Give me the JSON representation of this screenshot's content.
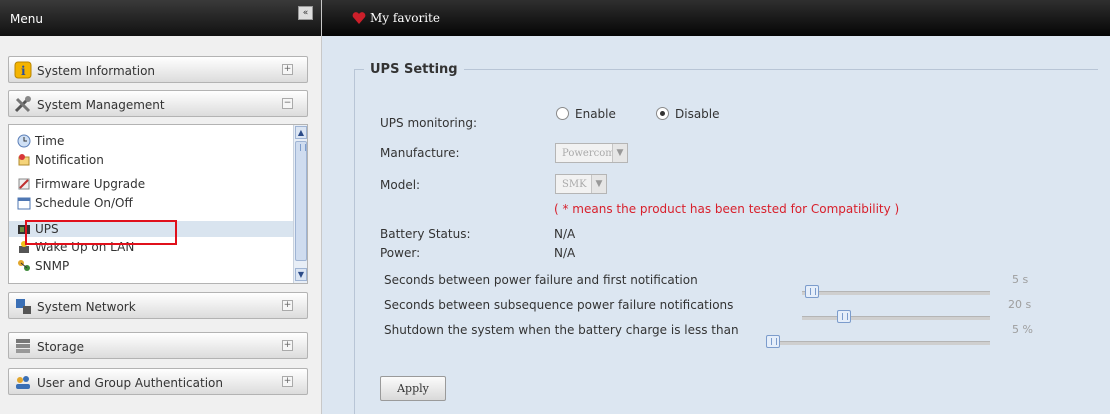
{
  "sidebar": {
    "title": "Menu",
    "collapse_glyph": "«",
    "categories": [
      {
        "label": "System Information",
        "icon": "info-icon",
        "toggle": "+"
      },
      {
        "label": "System Management",
        "icon": "tools-icon",
        "toggle": "−"
      },
      {
        "label": "System Network",
        "icon": "network-icon",
        "toggle": "+"
      },
      {
        "label": "Storage",
        "icon": "storage-icon",
        "toggle": "+"
      },
      {
        "label": "User and Group Authentication",
        "icon": "users-icon",
        "toggle": "+"
      }
    ],
    "submenu": [
      {
        "label": "Time",
        "icon": "clock-icon"
      },
      {
        "label": "Notification",
        "icon": "notification-icon"
      },
      {
        "label": "Firmware Upgrade",
        "icon": "firmware-icon"
      },
      {
        "label": "Schedule On/Off",
        "icon": "schedule-icon"
      },
      {
        "label": "UPS",
        "icon": "ups-icon",
        "selected": true
      },
      {
        "label": "Wake Up on LAN",
        "icon": "wol-icon"
      },
      {
        "label": "SNMP",
        "icon": "snmp-icon"
      }
    ]
  },
  "header": {
    "favorite": "My favorite",
    "icon": "heart-icon",
    "accent": "#cc1f2a"
  },
  "ups": {
    "legend": "UPS Setting",
    "monitoring_label": "UPS monitoring:",
    "enable_label": "Enable",
    "disable_label": "Disable",
    "monitoring_value": "Disable",
    "manufacture_label": "Manufacture:",
    "manufacture_value": "Powercom",
    "model_label": "Model:",
    "model_value": "SMK",
    "note": "( * means the product has been tested for Compatibility )",
    "battery_label": "Battery Status:",
    "battery_value": "N/A",
    "power_label": "Power:",
    "power_value": "N/A",
    "sliders": [
      {
        "label": "Seconds between power failure and first notification",
        "value": "5 s",
        "fraction": 0.02
      },
      {
        "label": "Seconds between subsequence power failure notifications",
        "value": "20 s",
        "fraction": 0.2
      },
      {
        "label": "Shutdown the system when the battery charge is less than",
        "value": "5 %",
        "fraction": 0.0
      }
    ],
    "apply_label": "Apply"
  },
  "colors": {
    "highlight_border": "#e0101b",
    "note_text": "#d8202c",
    "panel_bg": "#dce6f1"
  }
}
